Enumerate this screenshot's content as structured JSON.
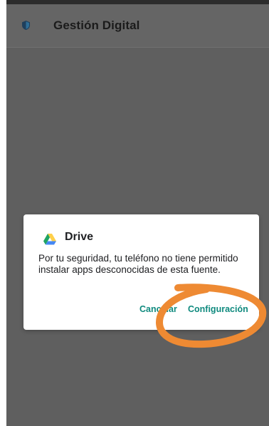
{
  "app_bar": {
    "icon": "shield-icon",
    "title": "Gestión Digital"
  },
  "dialog": {
    "icon": "google-drive-icon",
    "title": "Drive",
    "message": "Por tu seguridad, tu teléfono no tiene permitido instalar apps desconocidas de esta fuente.",
    "cancel_label": "Cancelar",
    "settings_label": "Configuración"
  },
  "colors": {
    "scrim": "#5f5f5f",
    "button_text": "#0f8a7e",
    "highlight_annotation": "#ee8a33"
  }
}
